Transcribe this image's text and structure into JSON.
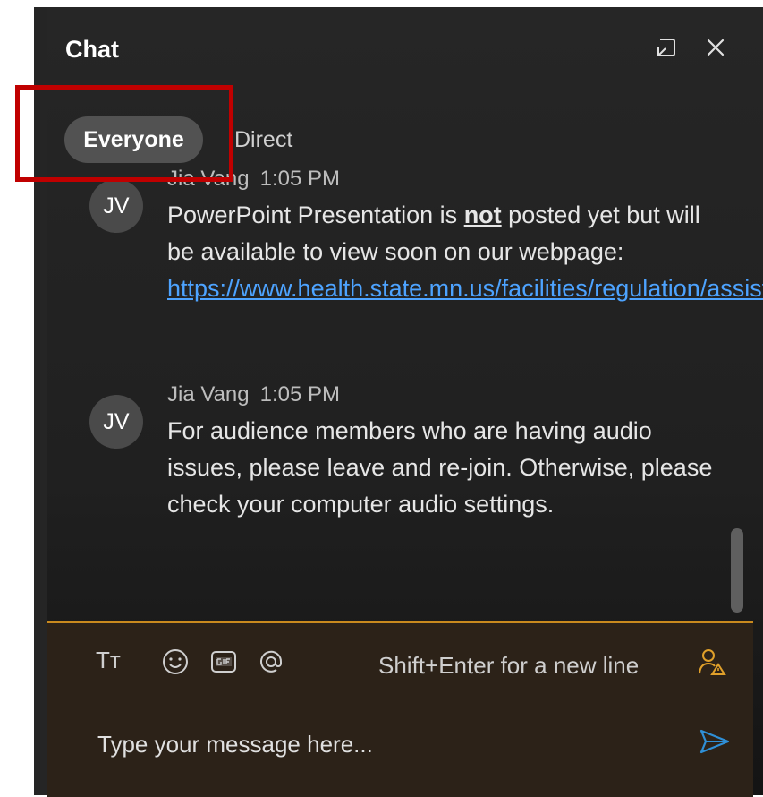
{
  "header": {
    "title": "Chat"
  },
  "tabs": [
    {
      "label": "Everyone",
      "active": true
    },
    {
      "label": "Direct",
      "active": false
    }
  ],
  "messages": [
    {
      "initials": "JV",
      "author": "Jia Vang",
      "time": "1:05 PM",
      "text_before": "PowerPoint Presentation is ",
      "text_bold": "not",
      "text_after": " posted yet but will be available to view soon on our webpage: ",
      "link": "https://www.health.state.mn.us/facilities/regulation/assistedliving/calls.html"
    },
    {
      "initials": "JV",
      "author": "Jia Vang",
      "time": "1:05 PM",
      "text": "For audience members who are having audio issues, please leave and re-join. Otherwise, please check your computer audio settings."
    }
  ],
  "composer": {
    "hint": "Shift+Enter for a new line",
    "placeholder": "Type your message here...",
    "format_icon_text": "Tᴛ"
  },
  "colors": {
    "accent": "#c98a1e",
    "link": "#4da3ff",
    "highlight_box": "#c00000",
    "send": "#2f8fd6"
  },
  "icons": [
    "popout-icon",
    "close-icon",
    "text-format-icon",
    "emoji-icon",
    "gif-icon",
    "mention-icon",
    "notification-icon",
    "send-icon"
  ]
}
